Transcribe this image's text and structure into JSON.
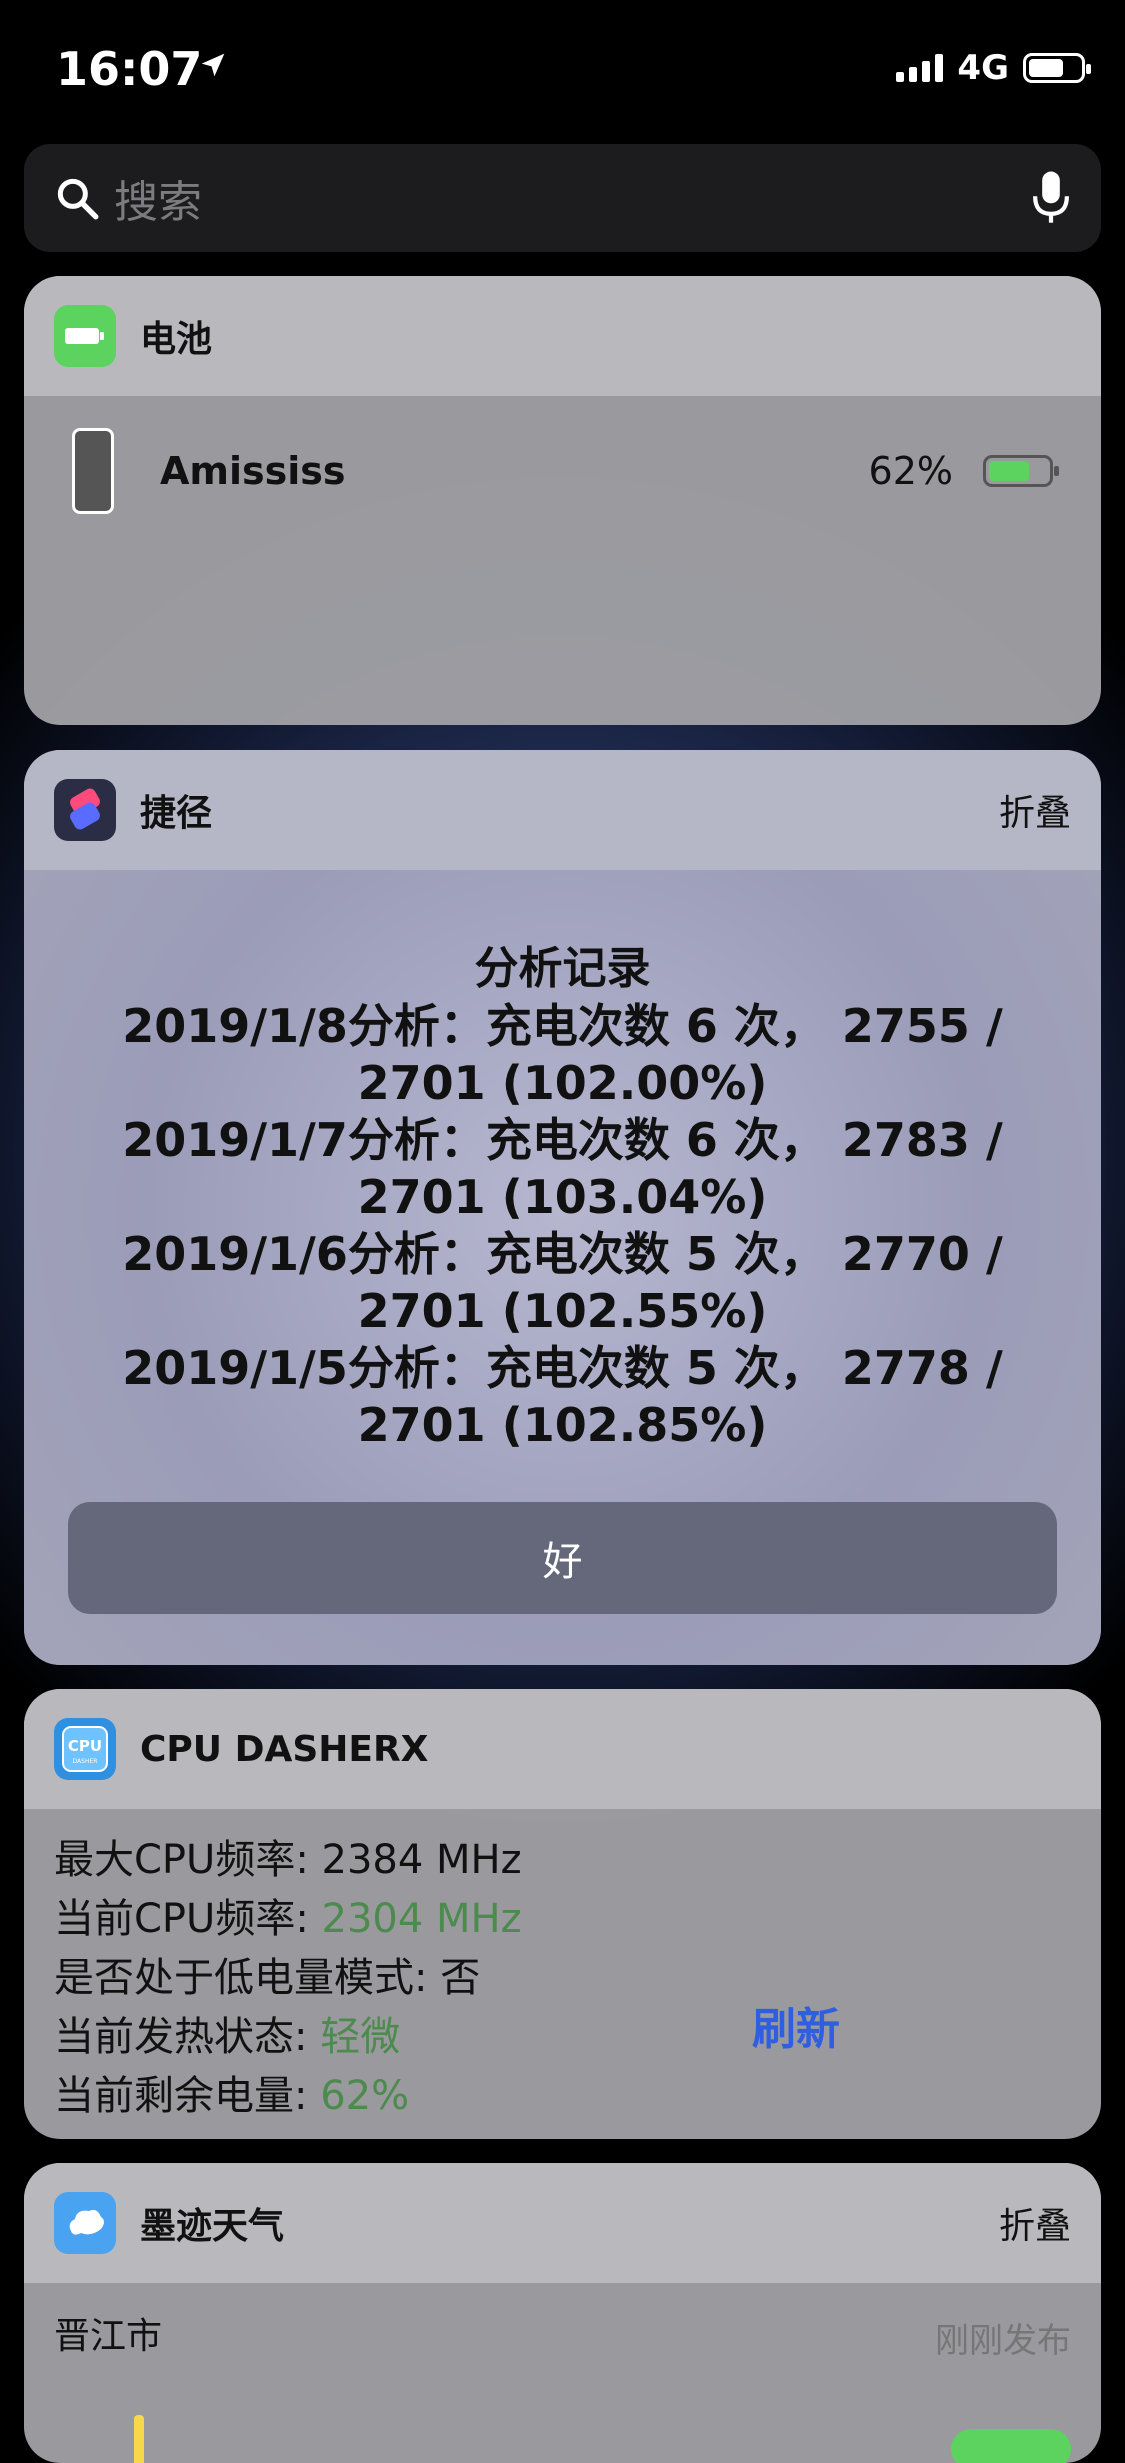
{
  "status_bar": {
    "time": "16:07",
    "network": "4G"
  },
  "search": {
    "placeholder": "搜索"
  },
  "battery_widget": {
    "title": "电池",
    "device_name": "Amississ",
    "percent": "62%",
    "battery_level": 0.62
  },
  "shortcuts_widget": {
    "title": "捷径",
    "action": "折叠",
    "dialog_title": "分析记录",
    "lines": [
      "2019/1/8分析：充电次数 6 次， 2755 /",
      "2701 (102.00%)",
      "2019/1/7分析：充电次数 6 次， 2783 /",
      "2701 (103.04%)",
      "2019/1/6分析：充电次数 5 次， 2770 /",
      "2701 (102.55%)",
      "2019/1/5分析：充电次数 5 次， 2778 /",
      "2701 (102.85%)"
    ],
    "ok_label": "好"
  },
  "cpu_widget": {
    "title": "CPU DASHERX",
    "rows": [
      {
        "label": "最大CPU频率: ",
        "value": "2384 MHz",
        "green": false
      },
      {
        "label": "当前CPU频率: ",
        "value": "2304 MHz",
        "green": true
      },
      {
        "label": "是否处于低电量模式: ",
        "value": "否",
        "green": false
      },
      {
        "label": "当前发热状态: ",
        "value": "轻微",
        "green": true
      },
      {
        "label": "当前剩余电量: ",
        "value": "62%",
        "green": true
      }
    ],
    "refresh_label": "刷新",
    "colors": {
      "green_text": "#4c8a4e",
      "refresh": "#2f5fe0"
    }
  },
  "weather_widget": {
    "title": "墨迹天气",
    "action": "折叠",
    "city": "晋江市",
    "update_text": "刚刚发布"
  }
}
